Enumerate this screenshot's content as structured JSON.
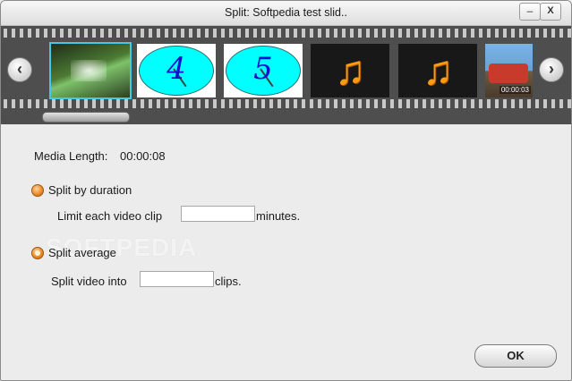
{
  "window": {
    "title": "Split: Softpedia test slid..",
    "minimize_glyph": "–",
    "close_glyph": "X"
  },
  "filmstrip": {
    "prev_glyph": "‹",
    "next_glyph": "›",
    "thumbnails": [
      {
        "kind": "video-forest",
        "selected": true
      },
      {
        "kind": "countdown",
        "digit": "4"
      },
      {
        "kind": "countdown",
        "digit": "5"
      },
      {
        "kind": "audio",
        "glyph": "♫"
      },
      {
        "kind": "audio",
        "glyph": "♫"
      },
      {
        "kind": "video-van",
        "timestamp": "00:00:03"
      }
    ]
  },
  "media": {
    "length_label": "Media Length:",
    "length_value": "00:00:08"
  },
  "options": {
    "by_duration": {
      "label": "Split by duration",
      "prefix": "Limit each video clip",
      "value": "",
      "suffix": "minutes."
    },
    "average": {
      "label": "Split average",
      "prefix": "Split video into",
      "value": "",
      "suffix": "clips."
    }
  },
  "watermark": "SOFTPEDIA",
  "buttons": {
    "ok_label": "OK"
  },
  "colors": {
    "selection_outline": "#41c9e6",
    "radio_orange": "#e8801a",
    "countdown_cyan": "#00ffff",
    "note_orange": "#ff9a12"
  }
}
